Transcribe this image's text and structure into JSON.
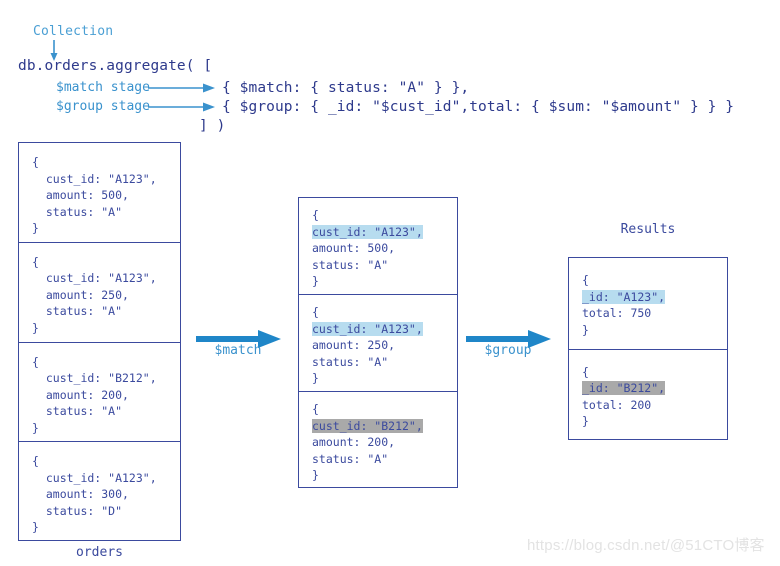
{
  "code": {
    "collection_label": "Collection",
    "line1": "db.orders.aggregate( [",
    "line2": "{ $match: { status: \"A\" } },",
    "line3": "{ $group: { _id: \"$cust_id\",total: { $sum: \"$amount\" } } }",
    "line4": "] )",
    "stage_match_label": "$match stage",
    "stage_group_label": "$group stage"
  },
  "orders": {
    "caption": "orders",
    "docs": [
      {
        "open": "{",
        "cust_id": "  cust_id: \"A123\",",
        "amount": "  amount: 500,",
        "status": "  status: \"A\"",
        "close": "}"
      },
      {
        "open": "{",
        "cust_id": "  cust_id: \"A123\",",
        "amount": "  amount: 250,",
        "status": "  status: \"A\"",
        "close": "}"
      },
      {
        "open": "{",
        "cust_id": "  cust_id: \"B212\",",
        "amount": "  amount: 200,",
        "status": "  status: \"A\"",
        "close": "}"
      },
      {
        "open": "{",
        "cust_id": "  cust_id: \"A123\",",
        "amount": "  amount: 300,",
        "status": "  status: \"D\"",
        "close": "}"
      }
    ]
  },
  "match_stage": {
    "arrow_label": "$match",
    "docs": [
      {
        "open": "{",
        "cust_id": "cust_id: \"A123\",",
        "highlight": "blue",
        "amount": "amount: 500,",
        "status": "status: \"A\"",
        "close": "}"
      },
      {
        "open": "{",
        "cust_id": "cust_id: \"A123\",",
        "highlight": "blue",
        "amount": "amount: 250,",
        "status": "status: \"A\"",
        "close": "}"
      },
      {
        "open": "{",
        "cust_id": "cust_id: \"B212\",",
        "highlight": "gray",
        "amount": "amount: 200,",
        "status": "status: \"A\"",
        "close": "}"
      }
    ]
  },
  "group_stage": {
    "arrow_label": "$group",
    "caption": "Results",
    "docs": [
      {
        "open": "{",
        "id": "_id: \"A123\",",
        "highlight": "blue",
        "total": "total: 750",
        "close": "}"
      },
      {
        "open": "{",
        "id": "_id: \"B212\",",
        "highlight": "gray",
        "total": "total: 200",
        "close": "}"
      }
    ]
  },
  "watermark": {
    "text": "https://blog.csdn.net/@51CTO博客"
  },
  "colors": {
    "ink": "#3b4a9e",
    "accent": "#3a92cd",
    "highlight_blue": "#b7dcef",
    "highlight_gray": "#a9a9a9"
  }
}
